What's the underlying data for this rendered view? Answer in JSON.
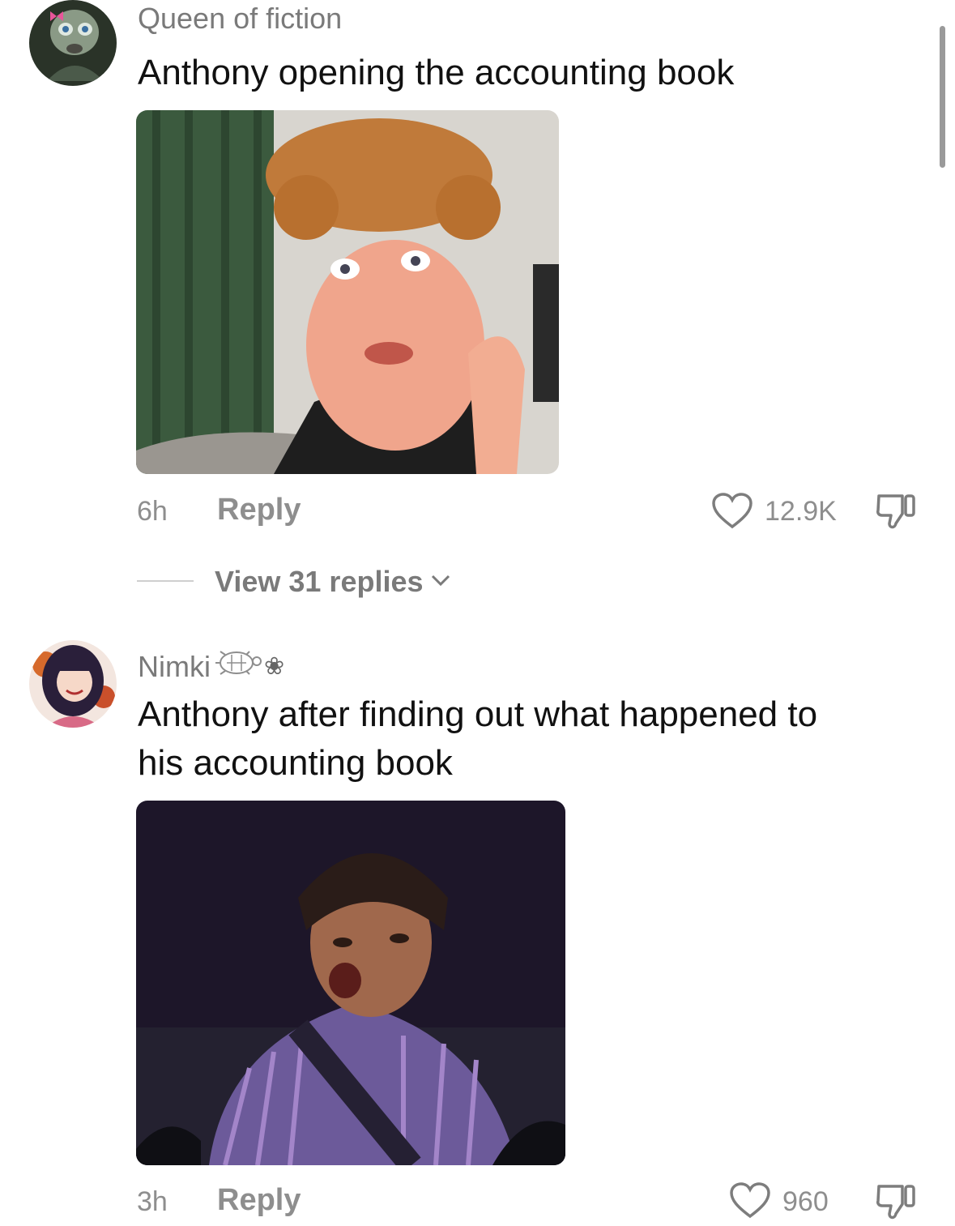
{
  "comments": [
    {
      "username": "Queen of fiction",
      "text": "Anthony opening the accounting book",
      "time": "6h",
      "reply_label": "Reply",
      "likes": "12.9K",
      "view_replies": "View 31 replies"
    },
    {
      "username": "Nimki",
      "username_decoration": "❀",
      "text_line1": "Anthony after finding out what happened to",
      "text_line2": "his accounting book",
      "time": "3h",
      "reply_label": "Reply",
      "likes": "960"
    }
  ],
  "icons": [
    "heart-icon",
    "dislike-icon",
    "chevron-down-icon",
    "turtle-icon",
    "flower-icon"
  ]
}
